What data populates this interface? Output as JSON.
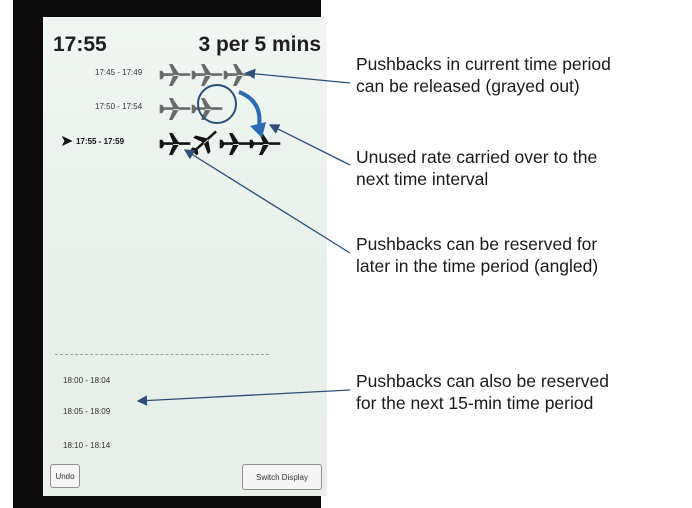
{
  "screen": {
    "clock": "17:55",
    "rate": "3 per 5 mins",
    "slots": [
      {
        "label": "17:45 - 17:49"
      },
      {
        "label": "17:50 - 17:54"
      },
      {
        "label": "17:55 - 17:59"
      }
    ],
    "future_slots": [
      {
        "label": "18:00 - 18:04"
      },
      {
        "label": "18:05 - 18:09"
      },
      {
        "label": "18:10 - 18:14"
      }
    ],
    "buttons": {
      "undo": "Undo",
      "switch_display": "Switch Display"
    },
    "colors": {
      "grayed_plane": "#6b6b6b",
      "active_plane": "#141414",
      "annotation": "#2c4f7c"
    }
  },
  "annotations": [
    {
      "lines": [
        "Pushbacks in current time period",
        "can be released (grayed out)"
      ]
    },
    {
      "lines": [
        "Unused rate carried over to the",
        "next time interval"
      ]
    },
    {
      "lines": [
        "Pushbacks can be reserved for",
        "later in the time period (angled)"
      ]
    },
    {
      "lines": [
        "Pushbacks can also be reserved",
        "for the next 15-min time period"
      ]
    }
  ]
}
